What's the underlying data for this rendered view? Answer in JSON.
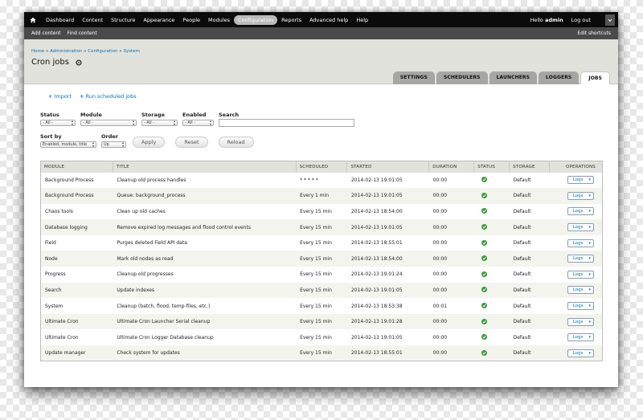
{
  "toolbar": {
    "items": [
      "Dashboard",
      "Content",
      "Structure",
      "Appearance",
      "People",
      "Modules",
      "Configuration",
      "Reports",
      "Advanced help",
      "Help"
    ],
    "active_index": 6,
    "hello_prefix": "Hello",
    "user": "admin",
    "logout": "Log out"
  },
  "shortcuts": {
    "items": [
      "Add content",
      "Find content"
    ],
    "edit": "Edit shortcuts"
  },
  "header": {
    "breadcrumb": [
      "Home",
      "Administration",
      "Configuration",
      "System"
    ],
    "breadcrumb_sep": "»",
    "title": "Cron jobs"
  },
  "tabs": [
    {
      "label": "SETTINGS",
      "active": false
    },
    {
      "label": "SCHEDULERS",
      "active": false
    },
    {
      "label": "LAUNCHERS",
      "active": false
    },
    {
      "label": "LOGGERS",
      "active": false
    },
    {
      "label": "JOBS",
      "active": true
    }
  ],
  "actions": {
    "import": "Import",
    "run": "Run scheduled jobs"
  },
  "filters": {
    "status_label": "Status",
    "status_value": "- All -",
    "module_label": "Module",
    "module_value": "- All -",
    "storage_label": "Storage",
    "storage_value": "- All -",
    "enabled_label": "Enabled",
    "enabled_value": "- All -",
    "search_label": "Search",
    "sortby_label": "Sort by",
    "sortby_value": "Enabled, module, title",
    "order_label": "Order",
    "order_value": "Up",
    "apply": "Apply",
    "reset": "Reset",
    "reload": "Reload"
  },
  "table": {
    "headers": [
      "MODULE",
      "TITLE",
      "SCHEDULED",
      "STARTED",
      "DURATION",
      "STATUS",
      "STORAGE",
      "OPERATIONS"
    ],
    "logs_label": "Logs",
    "rows": [
      {
        "module": "Background Process",
        "title": "Cleanup old process handles",
        "scheduled": "* * * * *",
        "started": "2014-02-13 19:01:05",
        "duration": "00:00",
        "storage": "Default"
      },
      {
        "module": "Background Process",
        "title": "Queue: background_process",
        "scheduled": "Every 1 min",
        "started": "2014-02-13 19:01:05",
        "duration": "00:00",
        "storage": "Default"
      },
      {
        "module": "Chaos tools",
        "title": "Clean up old caches",
        "scheduled": "Every 15 min",
        "started": "2014-02-13 18:54:00",
        "duration": "00:00",
        "storage": "Default"
      },
      {
        "module": "Database logging",
        "title": "Remove expired log messages and flood control events",
        "scheduled": "Every 15 min",
        "started": "2014-02-13 19:01:05",
        "duration": "00:00",
        "storage": "Default"
      },
      {
        "module": "Field",
        "title": "Purges deleted Field API data",
        "scheduled": "Every 15 min",
        "started": "2014-02-13 18:55:01",
        "duration": "00:00",
        "storage": "Default"
      },
      {
        "module": "Node",
        "title": "Mark old nodes as read",
        "scheduled": "Every 15 min",
        "started": "2014-02-13 18:54:00",
        "duration": "00:00",
        "storage": "Default"
      },
      {
        "module": "Progress",
        "title": "Cleanup old progresses",
        "scheduled": "Every 15 min",
        "started": "2014-02-13 19:01:24",
        "duration": "00:00",
        "storage": "Default"
      },
      {
        "module": "Search",
        "title": "Update indexes",
        "scheduled": "Every 15 min",
        "started": "2014-02-13 19:01:05",
        "duration": "00:00",
        "storage": "Default"
      },
      {
        "module": "System",
        "title": "Cleanup (batch, flood, temp-files, etc.)",
        "scheduled": "Every 15 min",
        "started": "2014-02-13 18:53:38",
        "duration": "00:01",
        "storage": "Default"
      },
      {
        "module": "Ultimate Cron",
        "title": "Ultimate Cron Launcher Serial cleanup",
        "scheduled": "Every 15 min",
        "started": "2014-02-13 19:01:28",
        "duration": "00:00",
        "storage": "Default"
      },
      {
        "module": "Ultimate Cron",
        "title": "Ultimate Cron Logger Database cleanup",
        "scheduled": "Every 15 min",
        "started": "2014-02-13 19:01:05",
        "duration": "00:00",
        "storage": "Default"
      },
      {
        "module": "Update manager",
        "title": "Check system for updates",
        "scheduled": "Every 15 min",
        "started": "2014-02-13 18:55:01",
        "duration": "00:00",
        "storage": "Default"
      }
    ]
  },
  "colors": {
    "link": "#0074bd",
    "toolbar_bg": "#0b0b0b",
    "shortcuts_bg": "#4a4a4a",
    "header_bg": "#e1e2dc",
    "status_ok": "#3a9b3a"
  },
  "icons": {
    "home": "home-icon",
    "gear": "gear-icon",
    "status_ok": "check-circle-icon",
    "toggle": "chevron-down-icon"
  }
}
